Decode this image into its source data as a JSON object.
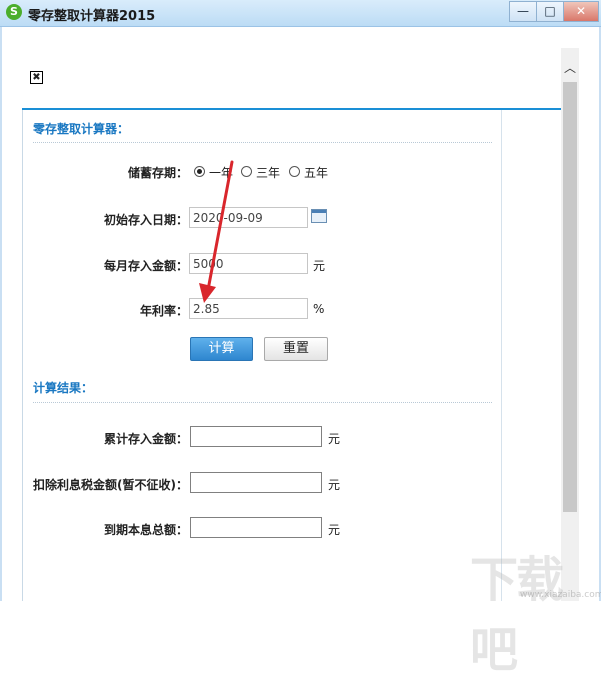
{
  "window": {
    "title": "零存整取计算器2015",
    "icon_glyph": "S",
    "buttons": {
      "minimize": "—",
      "maximize": "□",
      "close": "✕"
    }
  },
  "broken_image_glyph": "✖",
  "form": {
    "section_title": "零存整取计算器：",
    "term": {
      "label": "储蓄存期：",
      "options": [
        "一年",
        "三年",
        "五年"
      ],
      "selected": "一年"
    },
    "start_date": {
      "label": "初始存入日期：",
      "value": "2020-09-09"
    },
    "monthly_amount": {
      "label": "每月存入金额：",
      "value": "5000",
      "unit": "元"
    },
    "annual_rate": {
      "label": "年利率：",
      "value": "2.85",
      "unit": "%"
    },
    "buttons": {
      "calculate": "计算",
      "reset": "重置"
    }
  },
  "results": {
    "section_title": "计算结果：",
    "fields": [
      {
        "label": "累计存入金额：",
        "value": "",
        "unit": "元"
      },
      {
        "label": "扣除利息税金额(暂不征收)：",
        "value": "",
        "unit": "元"
      },
      {
        "label": "到期本息总额：",
        "value": "",
        "unit": "元"
      }
    ]
  },
  "annotation": {
    "arrow_color": "#d9262c"
  },
  "watermark": {
    "text": "下载吧",
    "url": "www.xiazaiba.com"
  },
  "colors": {
    "accent": "#1a8fd6",
    "primary_button": "#2e86cf"
  }
}
